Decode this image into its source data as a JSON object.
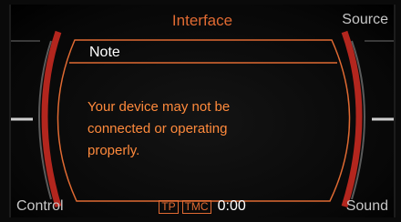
{
  "header": {
    "title": "Interface"
  },
  "softkeys": {
    "top_right": "Source",
    "bottom_left": "Control",
    "bottom_right": "Sound"
  },
  "dialog": {
    "title": "Note",
    "message_lines": [
      "Your device may not be",
      "connected or operating",
      "properly."
    ]
  },
  "status": {
    "tp_badge": "TP",
    "tmc_badge": "TMC",
    "clock": "0:00"
  },
  "colors": {
    "accent": "#e06a32",
    "message_text": "#ff8a3c",
    "softkey_text": "#c7c7c7",
    "frame_red": "#b3261e"
  }
}
